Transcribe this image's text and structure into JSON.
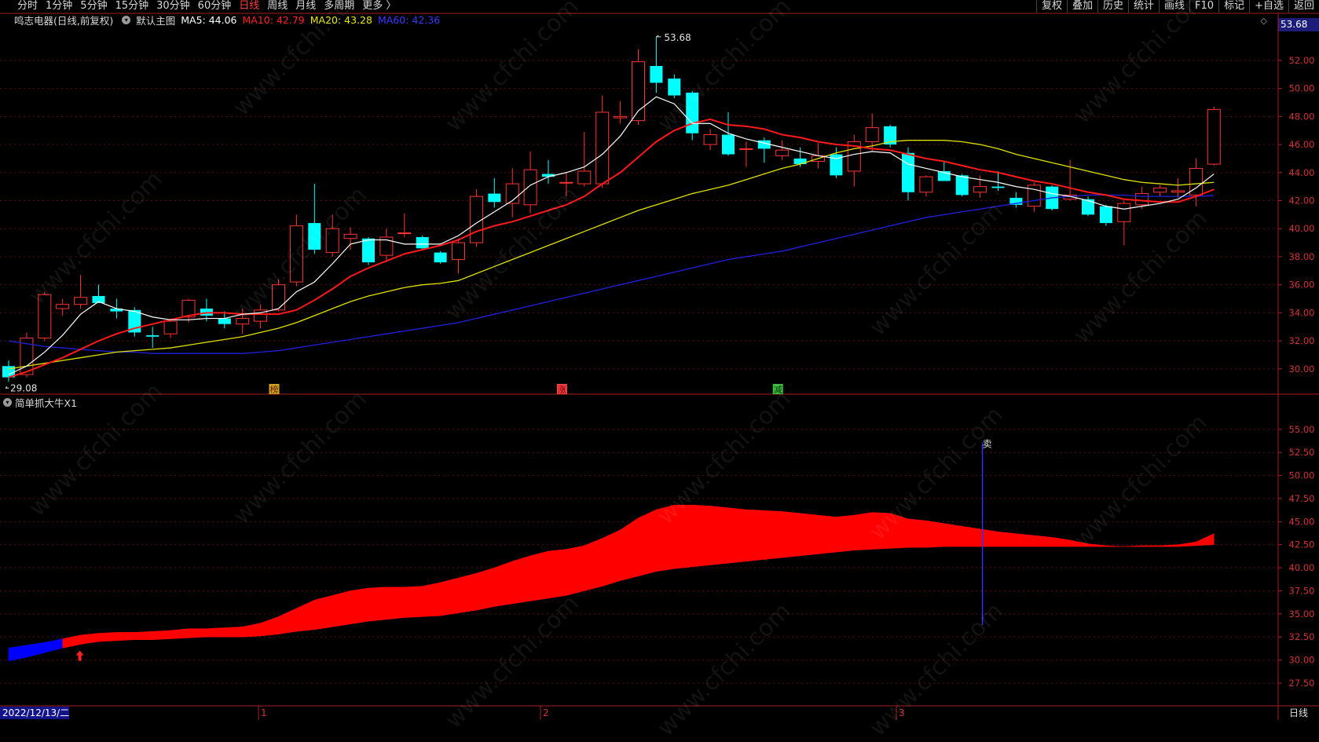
{
  "toolbar": {
    "periods": [
      "分时",
      "1分钟",
      "5分钟",
      "15分钟",
      "30分钟",
      "60分钟",
      "日线",
      "周线",
      "月线",
      "多周期",
      "更多 〉"
    ],
    "active_period": "日线",
    "right_buttons": [
      "复权",
      "叠加",
      "历史",
      "统计",
      "画线",
      "F10",
      "标记",
      "+自选",
      "返回"
    ]
  },
  "main_chart": {
    "stock_title": "鸣志电器(日线,前复权)",
    "template_label": "默认主图",
    "ma": [
      {
        "label": "MA5: 44.06",
        "color": "#ffffff"
      },
      {
        "label": "MA10: 42.79",
        "color": "#ff2020"
      },
      {
        "label": "MA20: 43.28",
        "color": "#e8e800"
      },
      {
        "label": "MA60: 42.36",
        "color": "#2b2bff"
      }
    ],
    "last_price": "53.68",
    "high_label": "53.68",
    "low_label": "29.08",
    "y_ticks": [
      "52.00",
      "50.00",
      "48.00",
      "46.00",
      "44.00",
      "42.00",
      "40.00",
      "38.00",
      "36.00",
      "34.00",
      "32.00",
      "30.00"
    ],
    "markers": [
      {
        "text": "榜",
        "bg": "#d4a020",
        "fg": "#5a1e00"
      },
      {
        "text": "涨",
        "bg": "#ff4040",
        "fg": "#600000"
      },
      {
        "text": "减",
        "bg": "#40c040",
        "fg": "#003000"
      }
    ]
  },
  "indicator": {
    "title": "简单抓大牛X1",
    "sell_label": "卖",
    "y_ticks": [
      "55.00",
      "52.50",
      "50.00",
      "47.50",
      "45.00",
      "42.50",
      "40.00",
      "37.50",
      "35.00",
      "32.50",
      "30.00",
      "27.50"
    ]
  },
  "bottom_axis": {
    "date_label": "2022/12/13/二",
    "months": [
      "1",
      "2",
      "3"
    ],
    "period_label": "日线"
  },
  "watermark": "www.cfchi.com",
  "chart_data": {
    "type": "candlestick",
    "candles": [
      {
        "o": 30.2,
        "h": 30.6,
        "l": 29.08,
        "c": 29.4
      },
      {
        "o": 29.6,
        "h": 32.6,
        "l": 29.4,
        "c": 32.2
      },
      {
        "o": 32.2,
        "h": 35.5,
        "l": 32.0,
        "c": 35.3
      },
      {
        "o": 34.3,
        "h": 35.0,
        "l": 33.8,
        "c": 34.6
      },
      {
        "o": 34.6,
        "h": 36.7,
        "l": 34.3,
        "c": 35.1
      },
      {
        "o": 35.2,
        "h": 36.0,
        "l": 34.7,
        "c": 34.7
      },
      {
        "o": 34.3,
        "h": 35.0,
        "l": 33.6,
        "c": 34.1
      },
      {
        "o": 34.2,
        "h": 34.4,
        "l": 32.3,
        "c": 32.6
      },
      {
        "o": 32.4,
        "h": 33.0,
        "l": 31.5,
        "c": 32.3
      },
      {
        "o": 32.5,
        "h": 33.6,
        "l": 32.2,
        "c": 33.4
      },
      {
        "o": 33.7,
        "h": 35.0,
        "l": 33.3,
        "c": 34.9
      },
      {
        "o": 34.3,
        "h": 35.0,
        "l": 33.4,
        "c": 33.8
      },
      {
        "o": 33.6,
        "h": 34.1,
        "l": 32.9,
        "c": 33.2
      },
      {
        "o": 33.2,
        "h": 34.3,
        "l": 32.5,
        "c": 33.6
      },
      {
        "o": 33.4,
        "h": 34.6,
        "l": 32.9,
        "c": 34.2
      },
      {
        "o": 34.2,
        "h": 36.4,
        "l": 34.1,
        "c": 36.0
      },
      {
        "o": 36.2,
        "h": 41.0,
        "l": 35.9,
        "c": 40.2
      },
      {
        "o": 40.4,
        "h": 43.2,
        "l": 38.2,
        "c": 38.5
      },
      {
        "o": 38.3,
        "h": 41.0,
        "l": 38.0,
        "c": 40.0
      },
      {
        "o": 39.3,
        "h": 40.1,
        "l": 38.5,
        "c": 39.6
      },
      {
        "o": 39.3,
        "h": 39.4,
        "l": 37.4,
        "c": 37.6
      },
      {
        "o": 38.1,
        "h": 40.0,
        "l": 37.6,
        "c": 39.4
      },
      {
        "o": 39.7,
        "h": 41.1,
        "l": 39.4,
        "c": 39.7
      },
      {
        "o": 39.4,
        "h": 39.5,
        "l": 38.5,
        "c": 38.6
      },
      {
        "o": 38.3,
        "h": 38.4,
        "l": 37.5,
        "c": 37.6
      },
      {
        "o": 37.8,
        "h": 39.3,
        "l": 36.8,
        "c": 39.0
      },
      {
        "o": 39.0,
        "h": 42.8,
        "l": 38.7,
        "c": 42.3
      },
      {
        "o": 42.5,
        "h": 43.6,
        "l": 41.5,
        "c": 41.9
      },
      {
        "o": 41.8,
        "h": 44.3,
        "l": 40.8,
        "c": 43.2
      },
      {
        "o": 41.7,
        "h": 45.5,
        "l": 41.1,
        "c": 44.2
      },
      {
        "o": 43.9,
        "h": 44.9,
        "l": 43.2,
        "c": 43.7
      },
      {
        "o": 43.3,
        "h": 44.0,
        "l": 42.3,
        "c": 43.3
      },
      {
        "o": 43.2,
        "h": 46.9,
        "l": 43.0,
        "c": 44.1
      },
      {
        "o": 43.2,
        "h": 49.5,
        "l": 42.9,
        "c": 48.3
      },
      {
        "o": 47.9,
        "h": 49.1,
        "l": 47.5,
        "c": 48.0
      },
      {
        "o": 47.7,
        "h": 52.8,
        "l": 47.4,
        "c": 51.9
      },
      {
        "o": 51.6,
        "h": 53.68,
        "l": 49.7,
        "c": 50.4
      },
      {
        "o": 50.7,
        "h": 51.0,
        "l": 49.3,
        "c": 49.5
      },
      {
        "o": 49.7,
        "h": 49.8,
        "l": 46.3,
        "c": 46.8
      },
      {
        "o": 46.0,
        "h": 47.1,
        "l": 45.6,
        "c": 46.7
      },
      {
        "o": 46.7,
        "h": 48.3,
        "l": 45.2,
        "c": 45.3
      },
      {
        "o": 45.7,
        "h": 46.2,
        "l": 44.4,
        "c": 45.7
      },
      {
        "o": 46.3,
        "h": 46.5,
        "l": 44.7,
        "c": 45.7
      },
      {
        "o": 45.2,
        "h": 46.3,
        "l": 44.9,
        "c": 45.6
      },
      {
        "o": 45.0,
        "h": 45.8,
        "l": 44.4,
        "c": 44.6
      },
      {
        "o": 44.8,
        "h": 46.1,
        "l": 44.3,
        "c": 45.2
      },
      {
        "o": 45.3,
        "h": 45.8,
        "l": 43.6,
        "c": 43.8
      },
      {
        "o": 44.1,
        "h": 46.7,
        "l": 43.0,
        "c": 46.2
      },
      {
        "o": 46.2,
        "h": 48.2,
        "l": 45.5,
        "c": 47.2
      },
      {
        "o": 47.3,
        "h": 47.4,
        "l": 45.8,
        "c": 46.0
      },
      {
        "o": 45.4,
        "h": 45.8,
        "l": 42.0,
        "c": 42.6
      },
      {
        "o": 42.6,
        "h": 43.8,
        "l": 42.3,
        "c": 43.7
      },
      {
        "o": 44.1,
        "h": 44.8,
        "l": 43.4,
        "c": 43.4
      },
      {
        "o": 43.8,
        "h": 43.9,
        "l": 42.3,
        "c": 42.4
      },
      {
        "o": 42.6,
        "h": 43.8,
        "l": 42.2,
        "c": 43.0
      },
      {
        "o": 43.0,
        "h": 44.1,
        "l": 42.7,
        "c": 42.9
      },
      {
        "o": 42.2,
        "h": 42.6,
        "l": 41.5,
        "c": 41.7
      },
      {
        "o": 41.6,
        "h": 43.3,
        "l": 41.2,
        "c": 43.1
      },
      {
        "o": 43.0,
        "h": 43.1,
        "l": 41.3,
        "c": 41.4
      },
      {
        "o": 42.1,
        "h": 44.9,
        "l": 42.0,
        "c": 42.4
      },
      {
        "o": 42.1,
        "h": 42.3,
        "l": 40.9,
        "c": 41.0
      },
      {
        "o": 41.6,
        "h": 41.7,
        "l": 40.2,
        "c": 40.4
      },
      {
        "o": 40.5,
        "h": 42.0,
        "l": 38.8,
        "c": 41.8
      },
      {
        "o": 41.7,
        "h": 43.0,
        "l": 41.4,
        "c": 42.5
      },
      {
        "o": 42.6,
        "h": 43.1,
        "l": 42.3,
        "c": 42.9
      },
      {
        "o": 42.6,
        "h": 43.6,
        "l": 42.2,
        "c": 42.7
      },
      {
        "o": 42.4,
        "h": 45.0,
        "l": 41.6,
        "c": 44.3
      },
      {
        "o": 44.6,
        "h": 48.7,
        "l": 44.5,
        "c": 48.5
      }
    ],
    "ma5": [
      29.6,
      30.2,
      31.2,
      32.4,
      33.9,
      34.8,
      34.3,
      34.1,
      33.7,
      33.5,
      33.5,
      33.6,
      33.6,
      33.9,
      34.0,
      34.3,
      35.5,
      36.2,
      37.5,
      38.9,
      39.2,
      39.2,
      38.9,
      38.9,
      38.9,
      39.5,
      40.4,
      41.2,
      42.0,
      43.1,
      43.7,
      44.0,
      44.4,
      45.3,
      46.6,
      48.4,
      49.4,
      48.9,
      47.5,
      47.5,
      46.8,
      46.4,
      46.1,
      45.8,
      45.5,
      45.2,
      45.0,
      45.3,
      45.5,
      45.4,
      44.6,
      44.3,
      44.0,
      43.7,
      43.5,
      43.3,
      43.0,
      42.8,
      42.5,
      42.3,
      42.0,
      41.6,
      41.4,
      41.6,
      41.8,
      42.1,
      42.9,
      43.9
    ],
    "ma10": [
      29.4,
      29.8,
      30.3,
      30.8,
      31.4,
      32.0,
      32.5,
      32.9,
      33.2,
      33.5,
      33.8,
      34.0,
      34.0,
      33.9,
      33.9,
      33.9,
      34.2,
      34.9,
      35.7,
      36.6,
      37.2,
      37.7,
      38.2,
      38.5,
      38.8,
      39.2,
      39.8,
      40.2,
      40.5,
      40.9,
      41.3,
      41.7,
      42.3,
      43.2,
      44.0,
      45.1,
      46.2,
      47.0,
      47.5,
      47.8,
      47.4,
      47.3,
      47.1,
      46.7,
      46.5,
      46.2,
      46.0,
      45.9,
      45.7,
      45.6,
      45.3,
      45.0,
      44.8,
      44.5,
      44.2,
      44.0,
      43.7,
      43.4,
      43.2,
      42.9,
      42.6,
      42.4,
      42.1,
      42.0,
      41.9,
      41.9,
      42.3,
      42.8
    ],
    "ma20": [
      30.0,
      30.2,
      30.4,
      30.6,
      30.8,
      31.0,
      31.2,
      31.3,
      31.4,
      31.5,
      31.7,
      31.9,
      32.1,
      32.3,
      32.6,
      32.9,
      33.3,
      33.8,
      34.3,
      34.8,
      35.2,
      35.5,
      35.8,
      36.0,
      36.1,
      36.3,
      36.8,
      37.3,
      37.8,
      38.3,
      38.8,
      39.3,
      39.8,
      40.3,
      40.8,
      41.3,
      41.7,
      42.1,
      42.5,
      42.8,
      43.1,
      43.5,
      43.9,
      44.3,
      44.6,
      45.0,
      45.4,
      45.7,
      45.9,
      46.2,
      46.3,
      46.3,
      46.3,
      46.2,
      46.0,
      45.7,
      45.3,
      45.0,
      44.7,
      44.4,
      44.1,
      43.8,
      43.5,
      43.3,
      43.2,
      43.1,
      43.2,
      43.3
    ],
    "ma60": [
      32.0,
      31.8,
      31.6,
      31.5,
      31.4,
      31.3,
      31.2,
      31.2,
      31.1,
      31.1,
      31.1,
      31.1,
      31.1,
      31.1,
      31.2,
      31.3,
      31.5,
      31.7,
      31.9,
      32.1,
      32.3,
      32.5,
      32.7,
      32.9,
      33.1,
      33.3,
      33.6,
      33.9,
      34.2,
      34.5,
      34.8,
      35.1,
      35.4,
      35.7,
      36.0,
      36.3,
      36.6,
      36.9,
      37.2,
      37.5,
      37.8,
      38.0,
      38.2,
      38.4,
      38.7,
      39.0,
      39.3,
      39.6,
      39.9,
      40.2,
      40.5,
      40.8,
      41.0,
      41.2,
      41.4,
      41.6,
      41.8,
      42.0,
      42.2,
      42.3,
      42.4,
      42.4,
      42.4,
      42.3,
      42.3,
      42.3,
      42.3,
      42.36
    ],
    "indicator_upper": [
      31.3,
      31.6,
      31.9,
      32.3,
      32.7,
      32.9,
      33.0,
      33.0,
      33.1,
      33.2,
      33.4,
      33.4,
      33.5,
      33.6,
      34.0,
      34.7,
      35.6,
      36.5,
      37.0,
      37.5,
      37.8,
      37.9,
      37.9,
      38.0,
      38.4,
      38.9,
      39.4,
      40.0,
      40.7,
      41.3,
      41.8,
      42.0,
      42.4,
      43.2,
      44.1,
      45.4,
      46.3,
      46.8,
      46.8,
      46.7,
      46.5,
      46.3,
      46.2,
      46.1,
      45.9,
      45.7,
      45.5,
      45.7,
      46.0,
      45.9,
      45.3,
      45.1,
      44.8,
      44.5,
      44.2,
      43.9,
      43.7,
      43.5,
      43.3,
      43.0,
      42.6,
      42.4,
      42.3,
      42.4,
      42.4,
      42.5,
      42.8,
      43.7
    ],
    "indicator_lower": [
      29.9,
      30.3,
      30.8,
      31.3,
      31.7,
      32.0,
      32.1,
      32.2,
      32.2,
      32.3,
      32.4,
      32.5,
      32.5,
      32.5,
      32.6,
      32.8,
      33.1,
      33.3,
      33.6,
      33.9,
      34.2,
      34.4,
      34.6,
      34.7,
      34.8,
      35.1,
      35.4,
      35.8,
      36.1,
      36.4,
      36.7,
      37.0,
      37.5,
      38.0,
      38.6,
      39.1,
      39.6,
      39.9,
      40.1,
      40.3,
      40.5,
      40.7,
      40.9,
      41.1,
      41.3,
      41.5,
      41.7,
      41.9,
      42.0,
      42.1,
      42.2,
      42.2,
      42.3,
      42.3,
      42.3,
      42.3,
      42.3,
      42.3,
      42.3,
      42.3,
      42.3,
      42.3,
      42.3,
      42.3,
      42.3,
      42.3,
      42.4,
      42.5
    ],
    "blue_until_index": 3,
    "buy_signal_index": 4,
    "sell_signal_index": 54,
    "sell_signal_range": [
      33.8,
      53.5
    ],
    "main_ylim": [
      28.2,
      54.4
    ],
    "indicator_ylim": [
      25.2,
      57.2
    ]
  }
}
